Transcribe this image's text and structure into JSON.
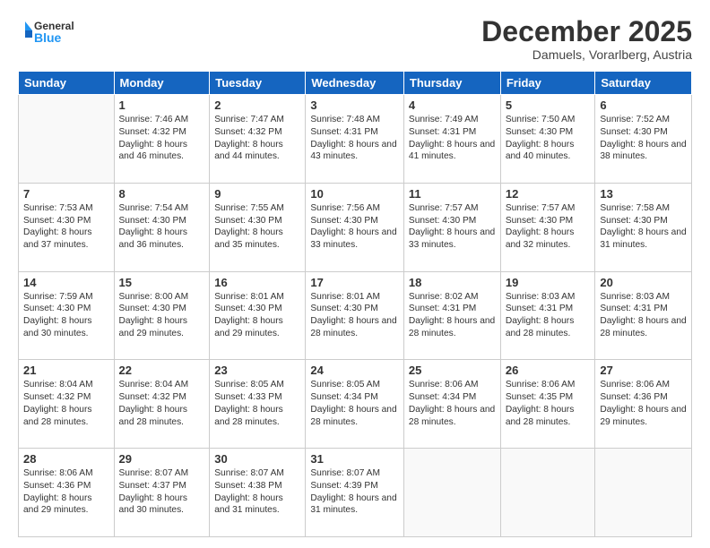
{
  "header": {
    "logo_general": "General",
    "logo_blue": "Blue",
    "month_title": "December 2025",
    "location": "Damuels, Vorarlberg, Austria"
  },
  "days_of_week": [
    "Sunday",
    "Monday",
    "Tuesday",
    "Wednesday",
    "Thursday",
    "Friday",
    "Saturday"
  ],
  "weeks": [
    [
      {
        "day": "",
        "info": ""
      },
      {
        "day": "1",
        "info": "Sunrise: 7:46 AM\nSunset: 4:32 PM\nDaylight: 8 hours\nand 46 minutes."
      },
      {
        "day": "2",
        "info": "Sunrise: 7:47 AM\nSunset: 4:32 PM\nDaylight: 8 hours\nand 44 minutes."
      },
      {
        "day": "3",
        "info": "Sunrise: 7:48 AM\nSunset: 4:31 PM\nDaylight: 8 hours\nand 43 minutes."
      },
      {
        "day": "4",
        "info": "Sunrise: 7:49 AM\nSunset: 4:31 PM\nDaylight: 8 hours\nand 41 minutes."
      },
      {
        "day": "5",
        "info": "Sunrise: 7:50 AM\nSunset: 4:30 PM\nDaylight: 8 hours\nand 40 minutes."
      },
      {
        "day": "6",
        "info": "Sunrise: 7:52 AM\nSunset: 4:30 PM\nDaylight: 8 hours\nand 38 minutes."
      }
    ],
    [
      {
        "day": "7",
        "info": "Sunrise: 7:53 AM\nSunset: 4:30 PM\nDaylight: 8 hours\nand 37 minutes."
      },
      {
        "day": "8",
        "info": "Sunrise: 7:54 AM\nSunset: 4:30 PM\nDaylight: 8 hours\nand 36 minutes."
      },
      {
        "day": "9",
        "info": "Sunrise: 7:55 AM\nSunset: 4:30 PM\nDaylight: 8 hours\nand 35 minutes."
      },
      {
        "day": "10",
        "info": "Sunrise: 7:56 AM\nSunset: 4:30 PM\nDaylight: 8 hours\nand 33 minutes."
      },
      {
        "day": "11",
        "info": "Sunrise: 7:57 AM\nSunset: 4:30 PM\nDaylight: 8 hours\nand 33 minutes."
      },
      {
        "day": "12",
        "info": "Sunrise: 7:57 AM\nSunset: 4:30 PM\nDaylight: 8 hours\nand 32 minutes."
      },
      {
        "day": "13",
        "info": "Sunrise: 7:58 AM\nSunset: 4:30 PM\nDaylight: 8 hours\nand 31 minutes."
      }
    ],
    [
      {
        "day": "14",
        "info": "Sunrise: 7:59 AM\nSunset: 4:30 PM\nDaylight: 8 hours\nand 30 minutes."
      },
      {
        "day": "15",
        "info": "Sunrise: 8:00 AM\nSunset: 4:30 PM\nDaylight: 8 hours\nand 29 minutes."
      },
      {
        "day": "16",
        "info": "Sunrise: 8:01 AM\nSunset: 4:30 PM\nDaylight: 8 hours\nand 29 minutes."
      },
      {
        "day": "17",
        "info": "Sunrise: 8:01 AM\nSunset: 4:30 PM\nDaylight: 8 hours\nand 28 minutes."
      },
      {
        "day": "18",
        "info": "Sunrise: 8:02 AM\nSunset: 4:31 PM\nDaylight: 8 hours\nand 28 minutes."
      },
      {
        "day": "19",
        "info": "Sunrise: 8:03 AM\nSunset: 4:31 PM\nDaylight: 8 hours\nand 28 minutes."
      },
      {
        "day": "20",
        "info": "Sunrise: 8:03 AM\nSunset: 4:31 PM\nDaylight: 8 hours\nand 28 minutes."
      }
    ],
    [
      {
        "day": "21",
        "info": "Sunrise: 8:04 AM\nSunset: 4:32 PM\nDaylight: 8 hours\nand 28 minutes."
      },
      {
        "day": "22",
        "info": "Sunrise: 8:04 AM\nSunset: 4:32 PM\nDaylight: 8 hours\nand 28 minutes."
      },
      {
        "day": "23",
        "info": "Sunrise: 8:05 AM\nSunset: 4:33 PM\nDaylight: 8 hours\nand 28 minutes."
      },
      {
        "day": "24",
        "info": "Sunrise: 8:05 AM\nSunset: 4:34 PM\nDaylight: 8 hours\nand 28 minutes."
      },
      {
        "day": "25",
        "info": "Sunrise: 8:06 AM\nSunset: 4:34 PM\nDaylight: 8 hours\nand 28 minutes."
      },
      {
        "day": "26",
        "info": "Sunrise: 8:06 AM\nSunset: 4:35 PM\nDaylight: 8 hours\nand 28 minutes."
      },
      {
        "day": "27",
        "info": "Sunrise: 8:06 AM\nSunset: 4:36 PM\nDaylight: 8 hours\nand 29 minutes."
      }
    ],
    [
      {
        "day": "28",
        "info": "Sunrise: 8:06 AM\nSunset: 4:36 PM\nDaylight: 8 hours\nand 29 minutes."
      },
      {
        "day": "29",
        "info": "Sunrise: 8:07 AM\nSunset: 4:37 PM\nDaylight: 8 hours\nand 30 minutes."
      },
      {
        "day": "30",
        "info": "Sunrise: 8:07 AM\nSunset: 4:38 PM\nDaylight: 8 hours\nand 31 minutes."
      },
      {
        "day": "31",
        "info": "Sunrise: 8:07 AM\nSunset: 4:39 PM\nDaylight: 8 hours\nand 31 minutes."
      },
      {
        "day": "",
        "info": ""
      },
      {
        "day": "",
        "info": ""
      },
      {
        "day": "",
        "info": ""
      }
    ]
  ]
}
